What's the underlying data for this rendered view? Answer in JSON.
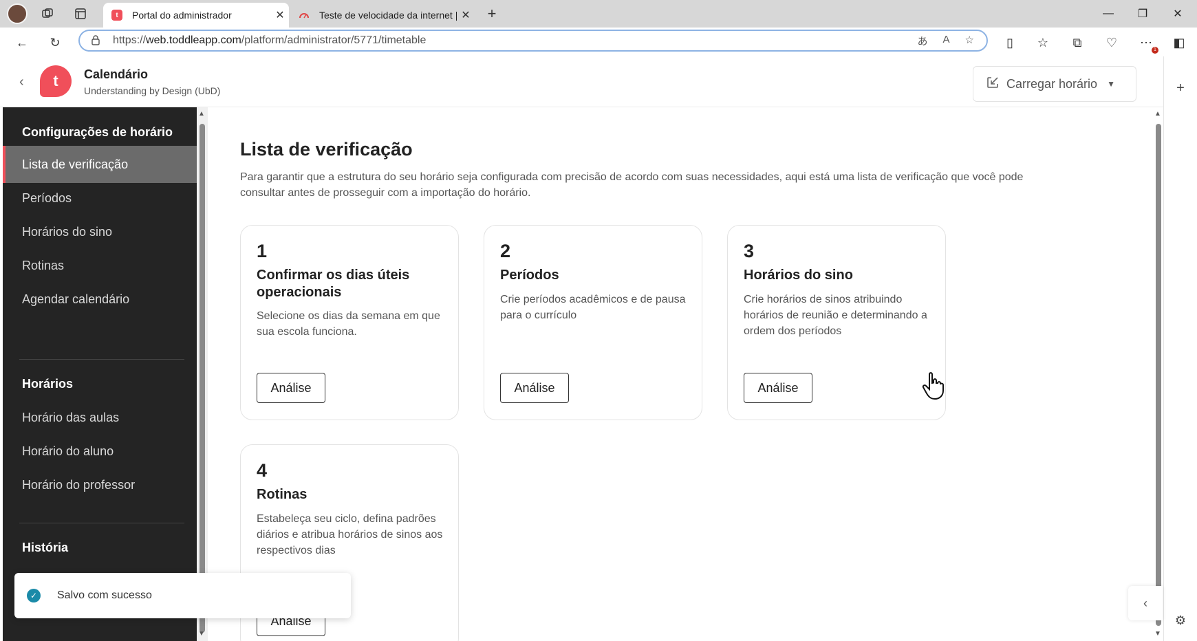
{
  "browser": {
    "tabs": [
      {
        "title": "Portal do administrador",
        "active": true,
        "favicon": "t"
      },
      {
        "title": "Teste de velocidade da internet |",
        "active": false,
        "favicon": "speedtest-icon"
      }
    ],
    "url_prefix": "https://",
    "url_domain": "web.toddleapp.com",
    "url_path": "/platform/administrator/5771/timetable",
    "notification_count": "1"
  },
  "header": {
    "title": "Calendário",
    "subtitle": "Understanding by Design (UbD)",
    "upload_label": "Carregar horário"
  },
  "sidebar": {
    "section1": "Configurações de horário",
    "items1": [
      {
        "label": "Lista de verificação",
        "active": true
      },
      {
        "label": "Períodos"
      },
      {
        "label": "Horários do sino"
      },
      {
        "label": "Rotinas"
      },
      {
        "label": "Agendar calendário"
      }
    ],
    "section2": "Horários",
    "items2": [
      {
        "label": "Horário das aulas"
      },
      {
        "label": "Horário do aluno"
      },
      {
        "label": "Horário do professor"
      }
    ],
    "section3": "História"
  },
  "main": {
    "title": "Lista de verificação",
    "intro": "Para garantir que a estrutura do seu horário seja configurada com precisão de acordo com suas necessidades, aqui está uma lista de verificação que você pode consultar antes de prosseguir com a importação do horário.",
    "cards": [
      {
        "num": "1",
        "title": "Confirmar os dias úteis operacionais",
        "desc": "Selecione os dias da semana em que sua escola funciona.",
        "button": "Análise"
      },
      {
        "num": "2",
        "title": "Períodos",
        "desc": "Crie períodos acadêmicos e de pausa para o currículo",
        "button": "Análise"
      },
      {
        "num": "3",
        "title": "Horários do sino",
        "desc": "Crie horários de sinos atribuindo horários de reunião e determinando a ordem dos períodos",
        "button": "Análise"
      },
      {
        "num": "4",
        "title": "Rotinas",
        "desc": "Estabeleça seu ciclo, defina padrões diários e atribua horários de sinos aos respectivos dias",
        "button": "Análise"
      }
    ]
  },
  "toast": {
    "message": "Salvo com sucesso"
  },
  "colors": {
    "brand": "#f04f5a",
    "sidebar_bg": "#242424",
    "success": "#1a8aa8"
  }
}
